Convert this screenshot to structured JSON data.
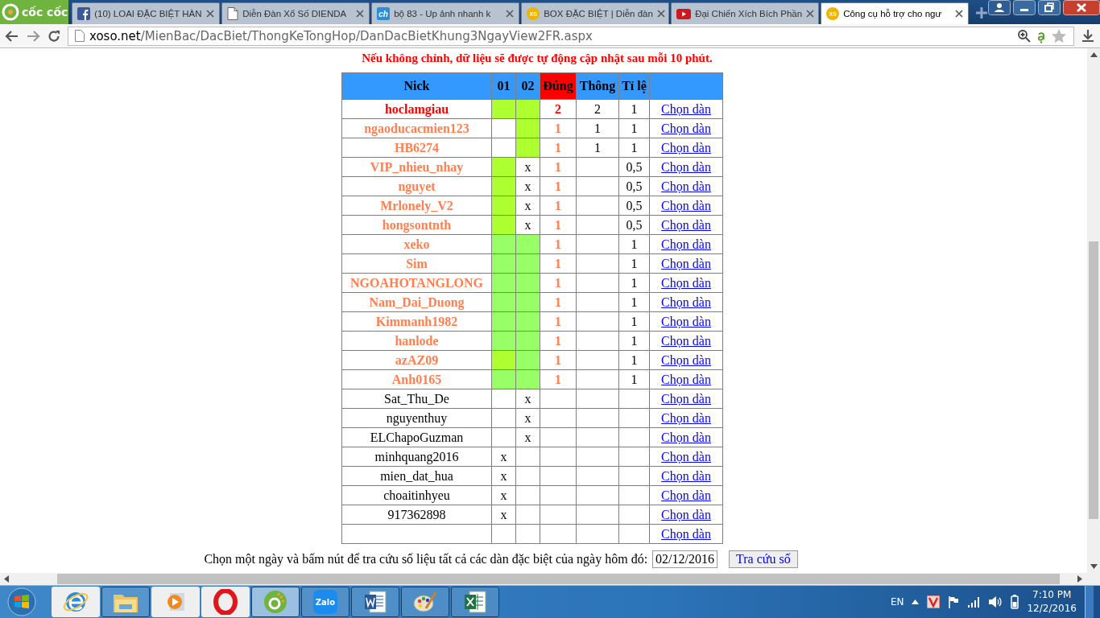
{
  "browser": {
    "logo": "cốc cốc",
    "tabs": [
      {
        "kind": "facebook",
        "title": "(10) LOAI ĐẶC BIỆT HÀN",
        "selected": false
      },
      {
        "kind": "page",
        "title": "Diễn Đàn Xổ Số DIENDA",
        "selected": false
      },
      {
        "kind": "ch",
        "favicon_text": "ch",
        "title": "bộ 83 - Up ảnh nhanh k",
        "selected": false
      },
      {
        "kind": "xs",
        "favicon_text": "XS",
        "title": "BOX ĐẶC BIỆT | Diễn đàn",
        "selected": false
      },
      {
        "kind": "youtube",
        "title": "Đại Chiến Xích Bích Phần",
        "selected": false
      },
      {
        "kind": "xs",
        "favicon_text": "XS",
        "title": "Công cụ hỗ trợ cho ngư",
        "selected": true
      }
    ],
    "address": {
      "host": "xoso.net",
      "path": "/MienBac/DacBiet/ThongKeTongHop/DanDacBietKhung3NgayView2FR.aspx"
    }
  },
  "page": {
    "notice": "Nếu không chỉnh, dữ liệu sẽ được tự động cập nhật sau mỗi 10 phút.",
    "table": {
      "columns": [
        {
          "label": "Nick",
          "highlighted": false
        },
        {
          "label": "01",
          "highlighted": false
        },
        {
          "label": "02",
          "highlighted": false
        },
        {
          "label": "Đúng",
          "highlighted": true
        },
        {
          "label": "Thông",
          "highlighted": false
        },
        {
          "label": "Tỉ lệ",
          "highlighted": false
        }
      ],
      "rows": [
        {
          "nick": "hoclamgiau",
          "color": "#ff0000",
          "c01": {
            "kind": "fill",
            "color": "#adff2f"
          },
          "c02": {
            "kind": "fill",
            "color": "#adff2f"
          },
          "dung": "2",
          "thong": "2",
          "ti_le": "1",
          "link": "Chọn dàn"
        },
        {
          "nick": "ngaoducacmien123",
          "color": "#ff7f50",
          "c01": {
            "kind": "blank"
          },
          "c02": {
            "kind": "fill",
            "color": "#adff2f"
          },
          "dung": "1",
          "thong": "1",
          "ti_le": "1",
          "link": "Chọn dàn"
        },
        {
          "nick": "HB6274",
          "color": "#ff7f50",
          "c01": {
            "kind": "blank"
          },
          "c02": {
            "kind": "fill",
            "color": "#adff2f"
          },
          "dung": "1",
          "thong": "1",
          "ti_le": "1",
          "link": "Chọn dàn"
        },
        {
          "nick": "VIP_nhieu_nhay",
          "color": "#ff7f50",
          "c01": {
            "kind": "fill",
            "color": "#adff2f"
          },
          "c02": {
            "kind": "text",
            "text": "x"
          },
          "dung": "1",
          "ti_le": "0,5",
          "link": "Chọn dàn"
        },
        {
          "nick": "nguyet",
          "color": "#ff7f50",
          "c01": {
            "kind": "fill",
            "color": "#adff2f"
          },
          "c02": {
            "kind": "text",
            "text": "x"
          },
          "dung": "1",
          "ti_le": "0,5",
          "link": "Chọn dàn"
        },
        {
          "nick": "Mrlonely_V2",
          "color": "#ff7f50",
          "c01": {
            "kind": "fill",
            "color": "#adff2f"
          },
          "c02": {
            "kind": "text",
            "text": "x"
          },
          "dung": "1",
          "ti_le": "0,5",
          "link": "Chọn dàn"
        },
        {
          "nick": "hongsontnth",
          "color": "#ff7f50",
          "c01": {
            "kind": "fill",
            "color": "#adff2f"
          },
          "c02": {
            "kind": "text",
            "text": "x"
          },
          "dung": "1",
          "ti_le": "0,5",
          "link": "Chọn dàn"
        },
        {
          "nick": "xeko",
          "color": "#ff7f50",
          "c01": {
            "kind": "fill",
            "color": "#99ff66"
          },
          "c02": {
            "kind": "fill",
            "color": "#99ff66"
          },
          "dung": "1",
          "ti_le": "1",
          "link": "Chọn dàn"
        },
        {
          "nick": "Sim",
          "color": "#ff7f50",
          "c01": {
            "kind": "fill",
            "color": "#99ff66"
          },
          "c02": {
            "kind": "fill",
            "color": "#99ff66"
          },
          "dung": "1",
          "ti_le": "1",
          "link": "Chọn dàn"
        },
        {
          "nick": "NGOAHOTANGLONG",
          "color": "#ff7f50",
          "c01": {
            "kind": "fill",
            "color": "#99ff66"
          },
          "c02": {
            "kind": "fill",
            "color": "#99ff66"
          },
          "dung": "1",
          "ti_le": "1",
          "link": "Chọn dàn"
        },
        {
          "nick": "Nam_Dai_Duong",
          "color": "#ff7f50",
          "c01": {
            "kind": "fill",
            "color": "#99ff66"
          },
          "c02": {
            "kind": "fill",
            "color": "#99ff66"
          },
          "dung": "1",
          "ti_le": "1",
          "link": "Chọn dàn"
        },
        {
          "nick": "Kimmanh1982",
          "color": "#ff7f50",
          "c01": {
            "kind": "fill",
            "color": "#99ff66"
          },
          "c02": {
            "kind": "fill",
            "color": "#99ff66"
          },
          "dung": "1",
          "ti_le": "1",
          "link": "Chọn dàn"
        },
        {
          "nick": "hanlode",
          "color": "#ff7f50",
          "c01": {
            "kind": "fill",
            "color": "#99ff66"
          },
          "c02": {
            "kind": "fill",
            "color": "#99ff66"
          },
          "dung": "1",
          "ti_le": "1",
          "link": "Chọn dàn"
        },
        {
          "nick": "azAZ09",
          "color": "#ff7f50",
          "c01": {
            "kind": "fill",
            "color": "#adff2f"
          },
          "c02": {
            "kind": "fill",
            "color": "#99ff66"
          },
          "dung": "1",
          "ti_le": "1",
          "link": "Chọn dàn"
        },
        {
          "nick": "Anh0165",
          "color": "#ff7f50",
          "c01": {
            "kind": "fill",
            "color": "#99ff66"
          },
          "c02": {
            "kind": "fill",
            "color": "#99ff66"
          },
          "dung": "1",
          "ti_le": "1",
          "link": "Chọn dàn"
        },
        {
          "nick": "Sat_Thu_De",
          "color": "#000000",
          "c01": {
            "kind": "blank"
          },
          "c02": {
            "kind": "text",
            "text": "x"
          },
          "link": "Chọn dàn"
        },
        {
          "nick": "nguyenthuy",
          "color": "#000000",
          "c01": {
            "kind": "blank"
          },
          "c02": {
            "kind": "text",
            "text": "x"
          },
          "link": "Chọn dàn"
        },
        {
          "nick": "ELChapoGuzman",
          "color": "#000000",
          "c01": {
            "kind": "blank"
          },
          "c02": {
            "kind": "text",
            "text": "x"
          },
          "link": "Chọn dàn"
        },
        {
          "nick": "minhquang2016",
          "color": "#000000",
          "c01": {
            "kind": "text",
            "text": "x"
          },
          "c02": {
            "kind": "blank"
          },
          "link": "Chọn dàn"
        },
        {
          "nick": "mien_dat_hua",
          "color": "#000000",
          "c01": {
            "kind": "text",
            "text": "x"
          },
          "c02": {
            "kind": "blank"
          },
          "link": "Chọn dàn"
        },
        {
          "nick": "choaitinhyeu",
          "color": "#000000",
          "c01": {
            "kind": "text",
            "text": "x"
          },
          "c02": {
            "kind": "blank"
          },
          "link": "Chọn dàn"
        },
        {
          "nick": "917362898",
          "color": "#000000",
          "c01": {
            "kind": "text",
            "text": "x"
          },
          "c02": {
            "kind": "blank"
          },
          "link": "Chọn dàn"
        },
        {
          "c01": {
            "kind": "blank"
          },
          "c02": {
            "kind": "blank"
          },
          "link": "Chọn dàn"
        }
      ]
    },
    "lookup": {
      "label": "Chọn một ngày và bấm nút để tra cứu số liệu tất cả các dàn đặc biệt của ngày hôm đó:",
      "date": "02/12/2016",
      "button": "Tra cứu số"
    }
  },
  "taskbar": {
    "items": [
      {
        "kind": "ie",
        "open": false,
        "active": false
      },
      {
        "kind": "folder",
        "open": true,
        "active": false
      },
      {
        "kind": "media",
        "open": false,
        "active": false
      },
      {
        "kind": "opera",
        "open": false,
        "active": false
      },
      {
        "kind": "coccoc",
        "open": true,
        "active": true
      },
      {
        "kind": "zalo",
        "label": "Zalo",
        "open": true,
        "active": false
      },
      {
        "kind": "word",
        "open": true,
        "active": false
      },
      {
        "kind": "paint",
        "open": true,
        "active": false
      },
      {
        "kind": "excel",
        "open": true,
        "active": false
      }
    ],
    "language": "EN",
    "time": "7:10 PM",
    "date": "12/2/2016"
  }
}
